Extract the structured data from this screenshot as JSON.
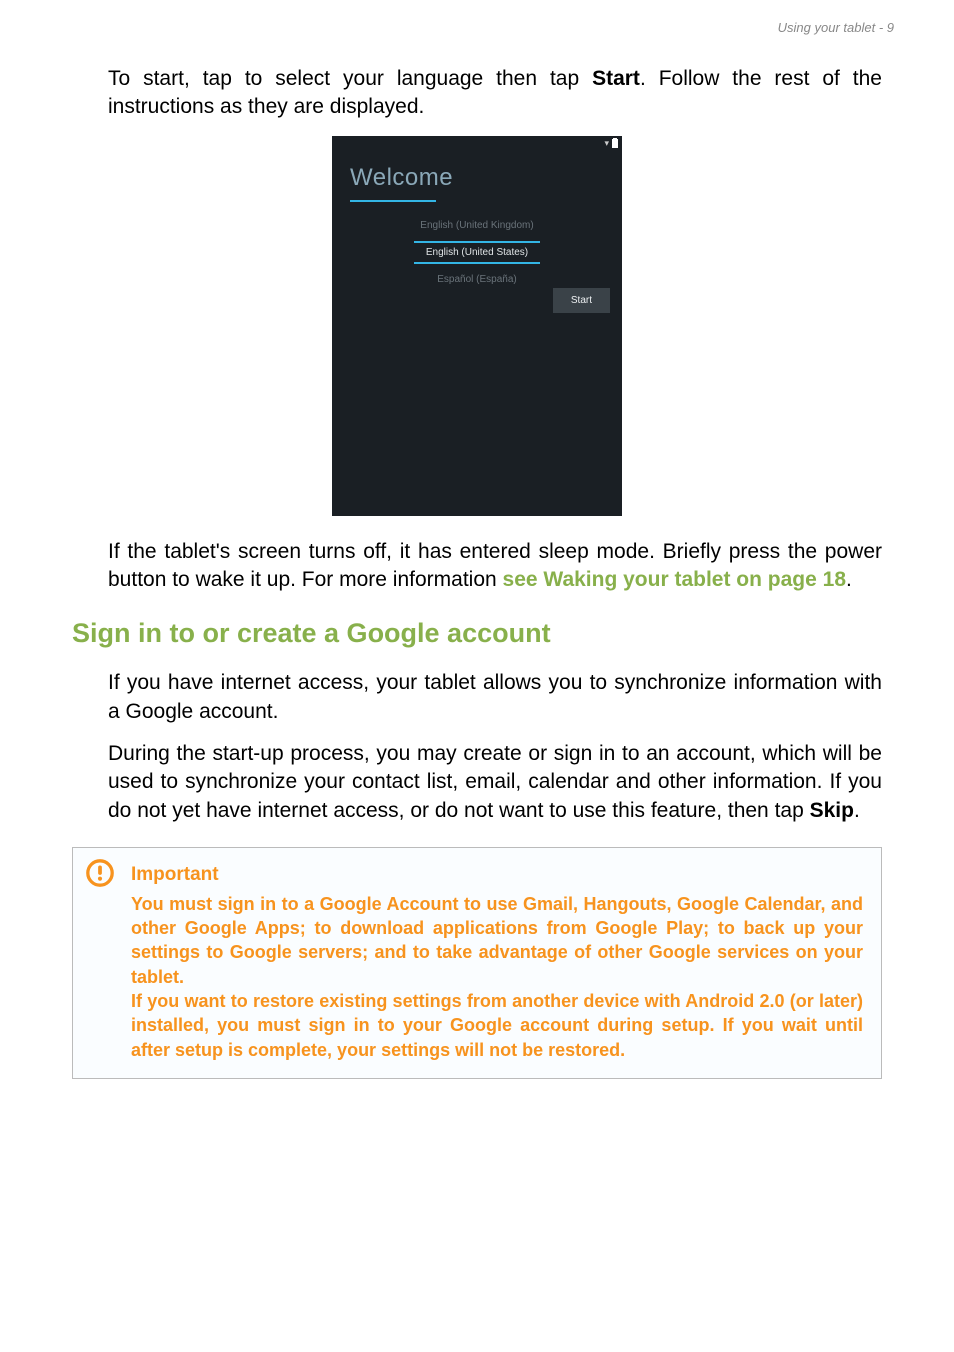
{
  "header": {
    "text": "Using your tablet - 9"
  },
  "para1": {
    "pre": "To start, tap to select your language then tap ",
    "bold": "Start",
    "post": ". Follow the rest of the instructions as they are displayed."
  },
  "screenshot": {
    "title": "Welcome",
    "languages": {
      "prev": "English (United Kingdom)",
      "current": "English (United States)",
      "next": "Español (España)"
    },
    "start_button": "Start"
  },
  "para2": {
    "pre": "If the tablet's screen turns off, it has entered sleep mode. Briefly press the power button to wake it up. For more information ",
    "link": "see Waking your tablet on page 18",
    "post": "."
  },
  "section": {
    "heading": "Sign in to or create a Google account"
  },
  "para3": "If you have internet access, your tablet allows you to synchronize information with a Google account.",
  "para4": {
    "pre": "During the start-up process, you may create or sign in to an account, which will be used to synchronize your contact list, email, calendar and other information. If you do not yet have internet access, or do not want to use this feature, then tap ",
    "bold": "Skip",
    "post": "."
  },
  "callout": {
    "title": "Important",
    "body1": "You must sign in to a Google Account to use Gmail, Hangouts, Google Calendar, and other Google Apps; to download applications from Google Play; to back up your settings to Google servers; and to take advantage of other Google services on your tablet.",
    "body2": "If you want to restore existing settings from another device with Android 2.0 (or later) installed, you must sign in to your Google account during setup. If you wait until after setup is complete, your settings will not be restored."
  }
}
